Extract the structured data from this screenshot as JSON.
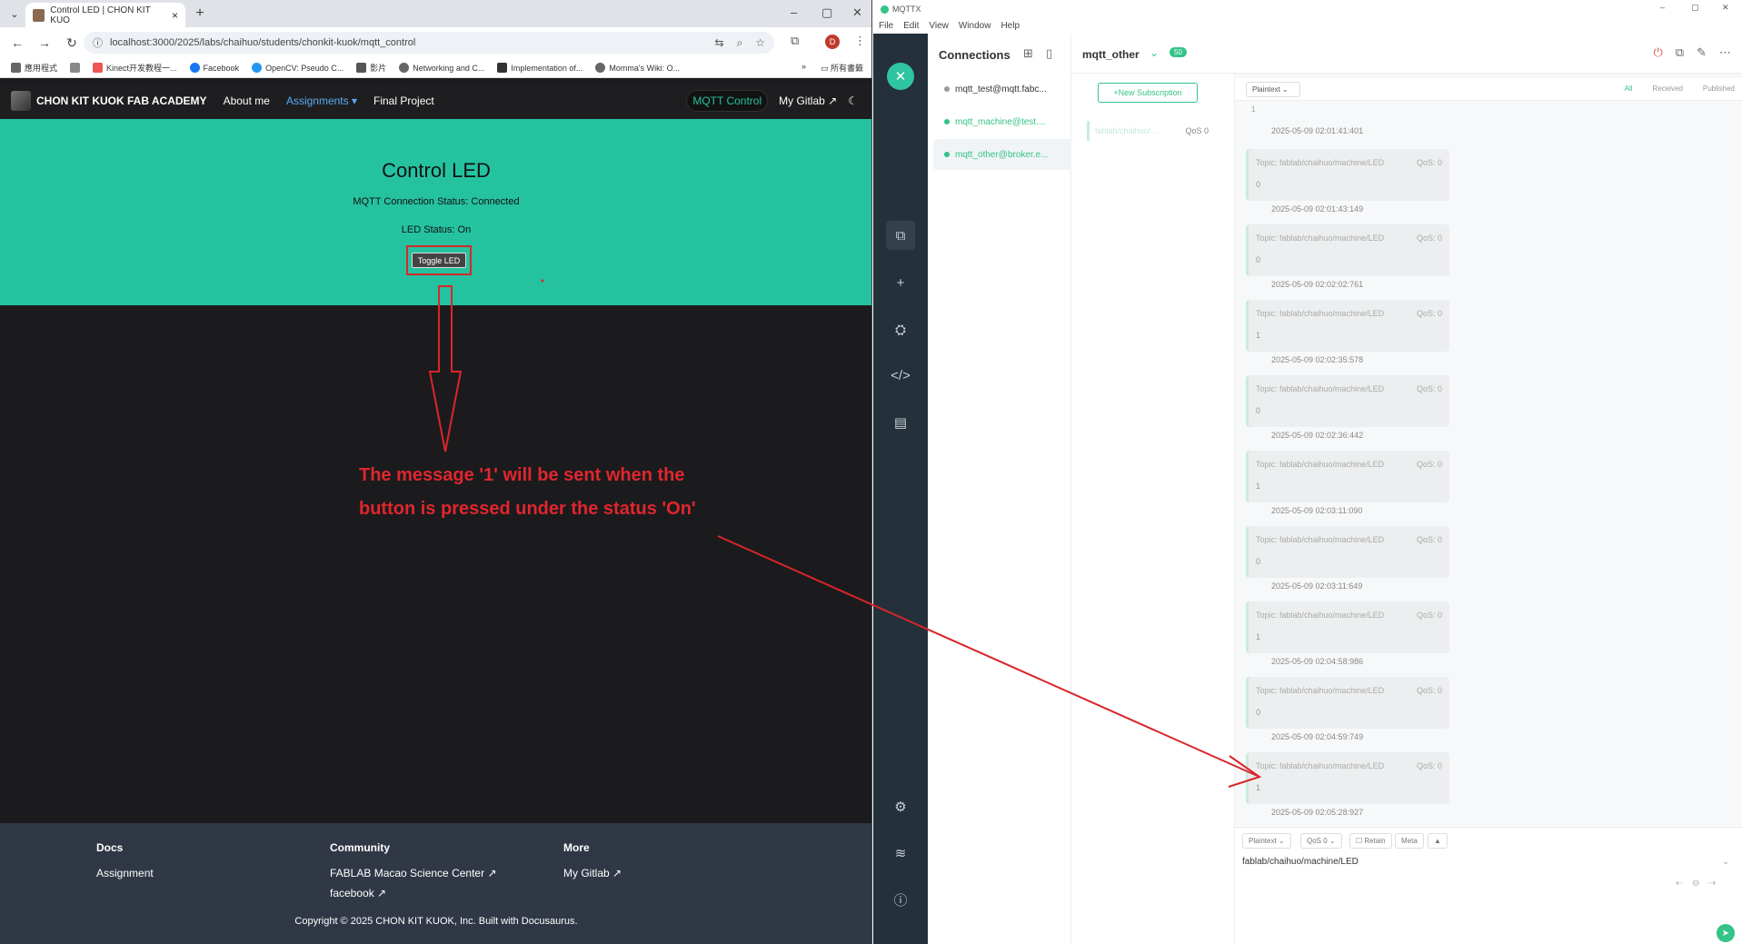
{
  "browser": {
    "tab_title": "Control LED | CHON KIT KUO",
    "url": "localhost:3000/2025/labs/chaihuo/students/chonkit-kuok/mqtt_control",
    "avatar_letter": "D",
    "bookmarks": [
      "應用程式",
      "Kinect开发教程一...",
      "Facebook",
      "OpenCV: Pseudo C...",
      "影片",
      "Networking and C...",
      "Implementation of...",
      "Momma's Wiki: O..."
    ],
    "bookmarks_more": "»",
    "bookmarks_all": "所有書籤"
  },
  "site": {
    "brand": "CHON KIT KUOK FAB ACADEMY",
    "nav": {
      "about": "About me",
      "assignments": "Assignments",
      "final": "Final Project"
    },
    "mqtt_control": "MQTT Control",
    "gitlab": "My Gitlab"
  },
  "hero": {
    "title": "Control LED",
    "connection_status": "MQTT Connection Status: Connected",
    "led_status": "LED Status: On",
    "toggle_label": "Toggle LED"
  },
  "annotation": {
    "line1": "The message '1' will be sent when the",
    "line2": "button is pressed under the status 'On'"
  },
  "footer": {
    "docs": {
      "heading": "Docs",
      "links": [
        "Assignment"
      ]
    },
    "community": {
      "heading": "Community",
      "links": [
        "FABLAB Macao Science Center",
        "facebook"
      ]
    },
    "more": {
      "heading": "More",
      "links": [
        "My Gitlab"
      ]
    },
    "copyright": "Copyright © 2025 CHON KIT KUOK, Inc. Built with Docusaurus."
  },
  "mqttx": {
    "window_title": "MQTTX",
    "menu": [
      "File",
      "Edit",
      "View",
      "Window",
      "Help"
    ],
    "connections_heading": "Connections",
    "connections": [
      {
        "name": "mqtt_test@mqtt.fabc...",
        "online": false
      },
      {
        "name": "mqtt_machine@test....",
        "online": true
      },
      {
        "name": "mqtt_other@broker.e...",
        "online": true
      }
    ],
    "active_connection": "mqtt_other",
    "badge": "50",
    "new_subscription": "New Subscription",
    "subscription": {
      "topic": "fablab/chaihuo/...",
      "qos": "QoS 0"
    },
    "format": "Plaintext",
    "filters": {
      "all": "All",
      "received": "Received",
      "published": "Published"
    },
    "partial_payload": "1",
    "first_timestamp": "2025-05-09 02:01:41:401",
    "messages": [
      {
        "topic": "Topic: fablab/chaihuo/machine/LED",
        "qos": "QoS: 0",
        "payload": "0",
        "time": "2025-05-09 02:01:43:149"
      },
      {
        "topic": "Topic: fablab/chaihuo/machine/LED",
        "qos": "QoS: 0",
        "payload": "0",
        "time": "2025-05-09 02:02:02:761"
      },
      {
        "topic": "Topic: fablab/chaihuo/machine/LED",
        "qos": "QoS: 0",
        "payload": "1",
        "time": "2025-05-09 02:02:35:578"
      },
      {
        "topic": "Topic: fablab/chaihuo/machine/LED",
        "qos": "QoS: 0",
        "payload": "0",
        "time": "2025-05-09 02:02:36:442"
      },
      {
        "topic": "Topic: fablab/chaihuo/machine/LED",
        "qos": "QoS: 0",
        "payload": "1",
        "time": "2025-05-09 02:03:11:090"
      },
      {
        "topic": "Topic: fablab/chaihuo/machine/LED",
        "qos": "QoS: 0",
        "payload": "0",
        "time": "2025-05-09 02:03:11:649"
      },
      {
        "topic": "Topic: fablab/chaihuo/machine/LED",
        "qos": "QoS: 0",
        "payload": "1",
        "time": "2025-05-09 02:04:58:986"
      },
      {
        "topic": "Topic: fablab/chaihuo/machine/LED",
        "qos": "QoS: 0",
        "payload": "0",
        "time": "2025-05-09 02:04:59:749"
      },
      {
        "topic": "Topic: fablab/chaihuo/machine/LED",
        "qos": "QoS: 0",
        "payload": "1",
        "time": "2025-05-09 02:05:28:927"
      }
    ],
    "composer": {
      "format": "Plaintext",
      "qos": "QoS 0",
      "retain": "Retain",
      "meta": "Meta",
      "topic": "fablab/chaihuo/machine/LED"
    }
  },
  "colors": {
    "accent": "#25c2a0",
    "mqtt_green": "#34c388",
    "annotation_red": "#e0262d",
    "footer_bg": "#303846"
  }
}
